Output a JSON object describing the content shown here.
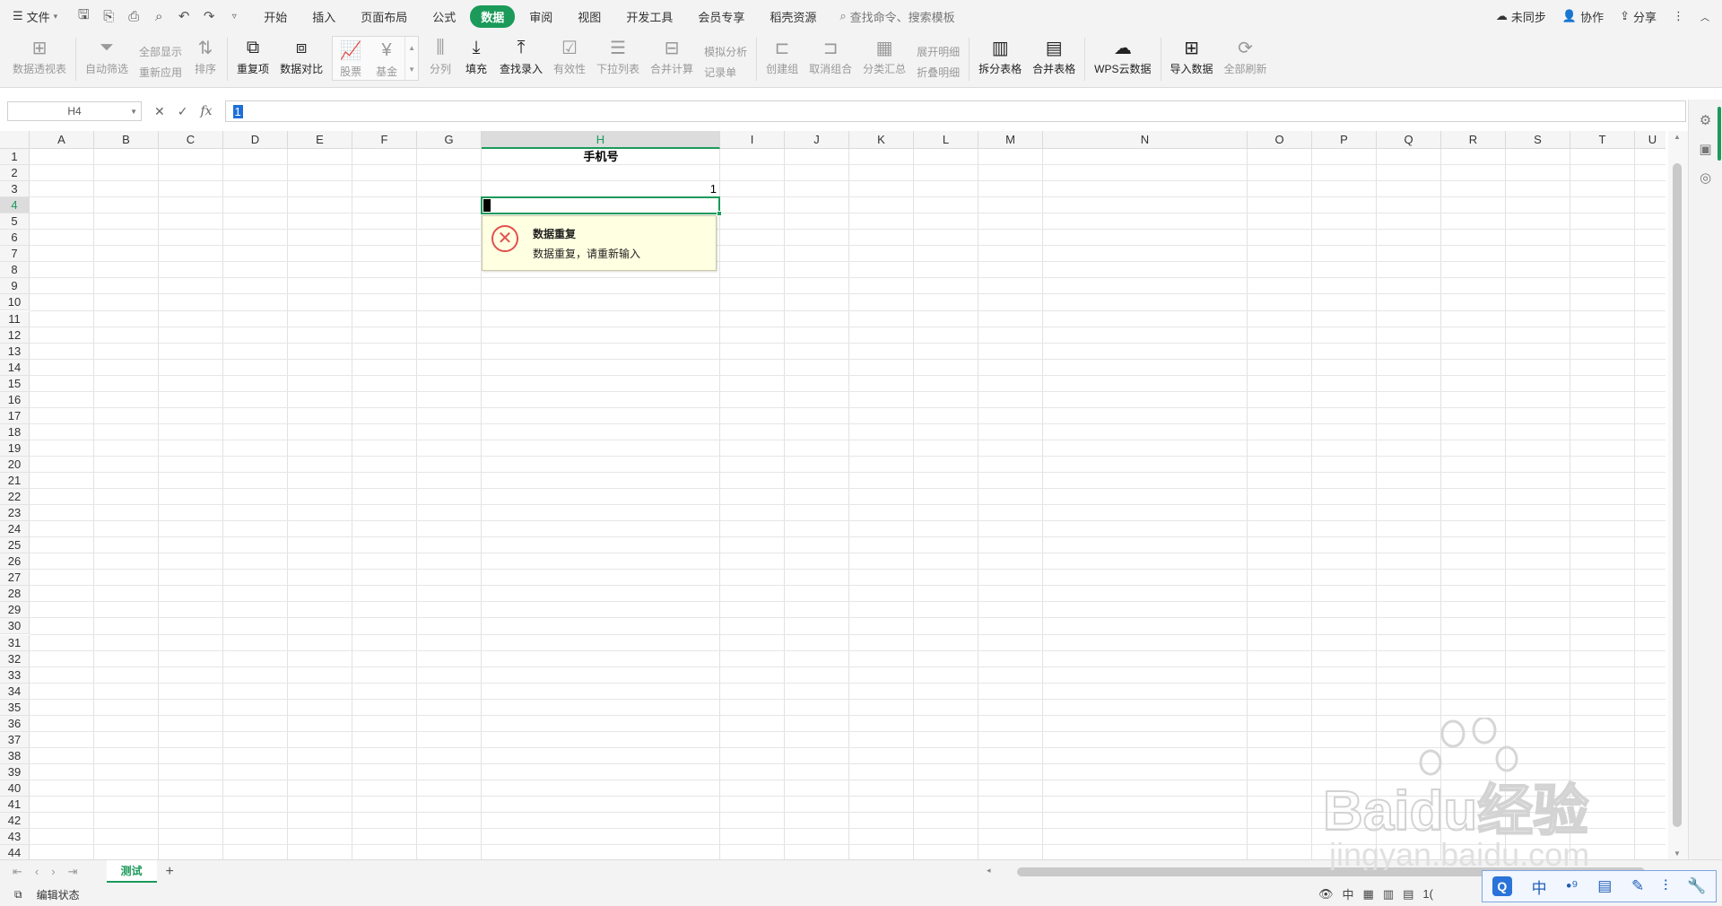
{
  "titlebar": {
    "file_label": "文件",
    "menu_tabs": [
      "开始",
      "插入",
      "页面布局",
      "公式",
      "数据",
      "审阅",
      "视图",
      "开发工具",
      "会员专享",
      "稻壳资源"
    ],
    "active_tab": "数据",
    "search_placeholder": "查找命令、搜索模板",
    "sync_label": "未同步",
    "collab_label": "协作",
    "share_label": "分享"
  },
  "ribbon": {
    "pivot": "数据透视表",
    "autofilter": "自动筛选",
    "show_all": "全部显示",
    "reapply": "重新应用",
    "sort": "排序",
    "duplicates": "重复项",
    "compare": "数据对比",
    "stock": "股票",
    "fund": "基金",
    "split_col": "分列",
    "fill": "填充",
    "find_entry": "查找录入",
    "validity": "有效性",
    "dropdown_list": "下拉列表",
    "consolidate": "合并计算",
    "simulate": "模拟分析",
    "record_form": "记录单",
    "create_group": "创建组",
    "ungroup": "取消组合",
    "subtotal": "分类汇总",
    "expand_detail": "展开明细",
    "collapse_detail": "折叠明细",
    "split_table": "拆分表格",
    "merge_table": "合并表格",
    "wps_cloud": "WPS云数据",
    "import_data": "导入数据",
    "refresh_all": "全部刷新"
  },
  "formula_bar": {
    "name_box": "H4",
    "value": "1"
  },
  "grid": {
    "columns": [
      "A",
      "B",
      "C",
      "D",
      "E",
      "F",
      "G",
      "H",
      "I",
      "J",
      "K",
      "L",
      "M",
      "N",
      "O",
      "P",
      "Q",
      "R",
      "S",
      "T",
      "U"
    ],
    "selected_column": "H",
    "rows": [
      "1",
      "2",
      "3",
      "4",
      "5",
      "6",
      "7",
      "8",
      "9",
      "10",
      "11",
      "12",
      "13",
      "14",
      "15",
      "16",
      "17",
      "18",
      "19",
      "20",
      "21",
      "22",
      "23",
      "24",
      "25",
      "26",
      "27",
      "28",
      "29",
      "30",
      "31",
      "32",
      "33",
      "34",
      "35",
      "36",
      "37",
      "38",
      "39",
      "40",
      "41",
      "42",
      "43",
      "44"
    ],
    "selected_row": "4",
    "cells": {
      "H1": "手机号",
      "H3": "1"
    }
  },
  "validation_tip": {
    "title": "数据重复",
    "message": "数据重复，请重新输入"
  },
  "sheets": {
    "tabs": [
      "测试"
    ],
    "active": "测试"
  },
  "status": {
    "mode": "编辑状态",
    "zoom_partial": "1("
  },
  "ime": {
    "mode": "中"
  },
  "watermark": {
    "brand": "Baidu经验",
    "url": "jingyan.baidu.com"
  },
  "colors": {
    "accent": "#1b9a5a",
    "error": "#e15050",
    "tip_bg": "#ffffe1",
    "selection_blue": "#1e6fd9"
  }
}
